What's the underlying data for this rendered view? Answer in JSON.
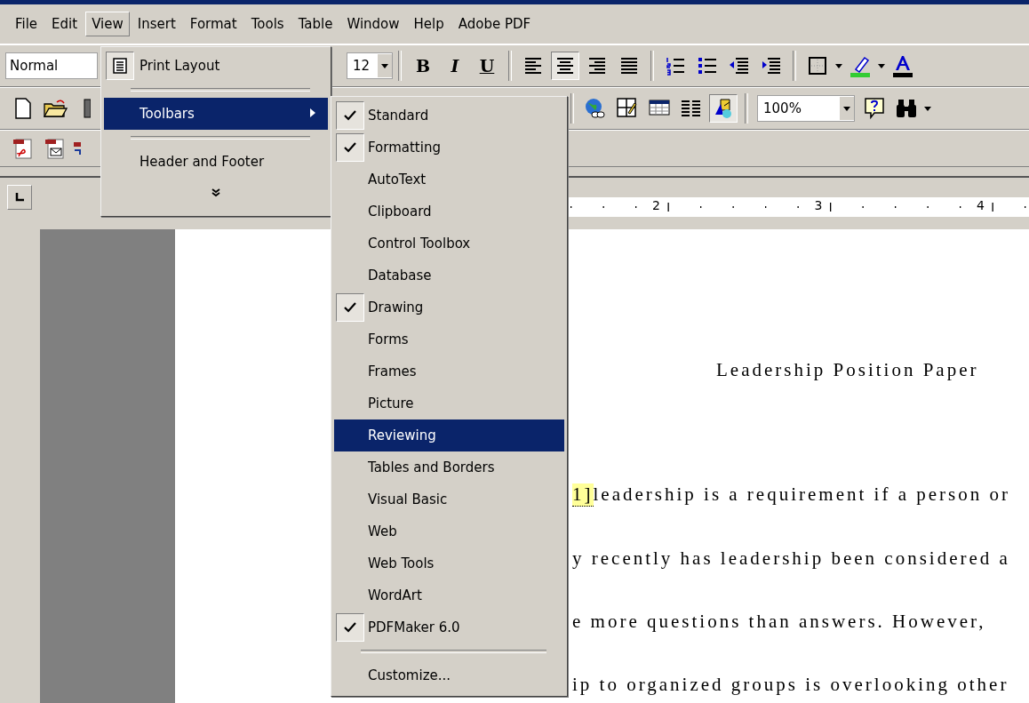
{
  "menu_bar": [
    {
      "label": "File",
      "selected": false
    },
    {
      "label": "Edit",
      "selected": false
    },
    {
      "label": "View",
      "selected": true
    },
    {
      "label": "Insert",
      "selected": false
    },
    {
      "label": "Format",
      "selected": false
    },
    {
      "label": "Tools",
      "selected": false
    },
    {
      "label": "Table",
      "selected": false
    },
    {
      "label": "Window",
      "selected": false
    },
    {
      "label": "Help",
      "selected": false
    },
    {
      "label": "Adobe PDF",
      "selected": false
    }
  ],
  "formatting_toolbar": {
    "style": "Normal",
    "font_size": "12",
    "text_buttons": [
      "B",
      "I",
      "U"
    ],
    "alignment": [
      {
        "selected": false
      },
      {
        "selected": true
      },
      {
        "selected": false
      },
      {
        "selected": false
      }
    ]
  },
  "standard_toolbar": {
    "right_buttons": [
      {
        "selected": false
      },
      {
        "selected": false
      },
      {
        "selected": false
      },
      {
        "selected": false
      },
      {
        "selected": true
      }
    ],
    "zoom": "100%"
  },
  "ruler": {
    "labels": [
      "2",
      "3",
      "4"
    ]
  },
  "document": {
    "title": "Leadership Position Paper",
    "comment_mark": "1]",
    "lines": [
      "leadership is a requirement if a person or",
      "y recently has leadership been considered a",
      "e more questions than answers.  However,",
      "ip to organized groups is overlooking other"
    ]
  },
  "view_menu": {
    "items": [
      {
        "kind": "command",
        "label": "Print Layout",
        "checked": true,
        "selected": false
      },
      {
        "kind": "separator"
      },
      {
        "kind": "submenu",
        "label": "Toolbars",
        "selected": true
      },
      {
        "kind": "separator"
      },
      {
        "kind": "command",
        "label": "Header and Footer",
        "checked": false,
        "selected": false
      },
      {
        "kind": "expand"
      }
    ]
  },
  "toolbars_menu": {
    "items": [
      {
        "kind": "toggle",
        "label": "Standard",
        "checked": true,
        "selected": false
      },
      {
        "kind": "toggle",
        "label": "Formatting",
        "checked": true,
        "selected": false
      },
      {
        "kind": "toggle",
        "label": "AutoText",
        "checked": false,
        "selected": false
      },
      {
        "kind": "toggle",
        "label": "Clipboard",
        "checked": false,
        "selected": false
      },
      {
        "kind": "toggle",
        "label": "Control Toolbox",
        "checked": false,
        "selected": false
      },
      {
        "kind": "toggle",
        "label": "Database",
        "checked": false,
        "selected": false
      },
      {
        "kind": "toggle",
        "label": "Drawing",
        "checked": true,
        "selected": false
      },
      {
        "kind": "toggle",
        "label": "Forms",
        "checked": false,
        "selected": false
      },
      {
        "kind": "toggle",
        "label": "Frames",
        "checked": false,
        "selected": false
      },
      {
        "kind": "toggle",
        "label": "Picture",
        "checked": false,
        "selected": false
      },
      {
        "kind": "toggle",
        "label": "Reviewing",
        "checked": false,
        "selected": true
      },
      {
        "kind": "toggle",
        "label": "Tables and Borders",
        "checked": false,
        "selected": false
      },
      {
        "kind": "toggle",
        "label": "Visual Basic",
        "checked": false,
        "selected": false
      },
      {
        "kind": "toggle",
        "label": "Web",
        "checked": false,
        "selected": false
      },
      {
        "kind": "toggle",
        "label": "Web Tools",
        "checked": false,
        "selected": false
      },
      {
        "kind": "toggle",
        "label": "WordArt",
        "checked": false,
        "selected": false
      },
      {
        "kind": "toggle",
        "label": "PDFMaker 6.0",
        "checked": true,
        "selected": false
      },
      {
        "kind": "separator"
      },
      {
        "kind": "command",
        "label": "Customize...",
        "selected": false
      }
    ]
  }
}
